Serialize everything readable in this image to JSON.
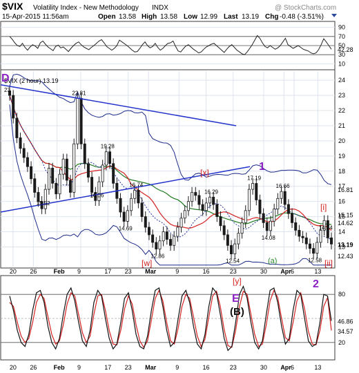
{
  "header": {
    "symbol": "$VIX",
    "name": "Volatility Index - New Methodology",
    "exchange": "INDX",
    "watermark": "@ StockCharts.com",
    "date": "15-Apr-2015 11:56am",
    "open_label": "Open",
    "open": "13.58",
    "high_label": "High",
    "high": "13.58",
    "low_label": "Low",
    "low": "12.99",
    "last_label": "Last",
    "last": "13.19",
    "chg_label": "Chg",
    "chg": "-0.48 (-3.51%)"
  },
  "colors": {
    "price": "#1a1a1a",
    "ma_red": "#d42020",
    "ma_green": "#1f7a1f",
    "ma_blue_dot": "#2030a0",
    "band": "#1c2a8a",
    "annot_purple": "#8a1fc4",
    "annot_red": "#d42020",
    "annot_green": "#2a8a2a",
    "trend": "#2233cc",
    "grid": "#dde4ee",
    "stoch_k": "#111111",
    "stoch_d": "#d42020"
  },
  "chart_data": [
    {
      "type": "line",
      "panel": "RSI",
      "ylim": [
        0,
        100
      ],
      "yticks": [
        "90",
        "70",
        "50",
        "30",
        "10"
      ],
      "ref_lines": [
        70,
        50,
        30
      ],
      "last_value_label": "42.28",
      "last_value": 42.28,
      "values": [
        70,
        64,
        56,
        50,
        48,
        55,
        46,
        40,
        47,
        52,
        49,
        44,
        56,
        60,
        53,
        47,
        43,
        39,
        48,
        51,
        45,
        47,
        42,
        37,
        44,
        50,
        55,
        58,
        52,
        47,
        44,
        41,
        46,
        50,
        55,
        60,
        63,
        56,
        48,
        44,
        40,
        44,
        50,
        62,
        58,
        54,
        50,
        45,
        40,
        36,
        37,
        44,
        52,
        58,
        50,
        45,
        48,
        55,
        46,
        40,
        44,
        50,
        55,
        56,
        60,
        48,
        38,
        36,
        43,
        49,
        52,
        47,
        42,
        38,
        34,
        36,
        42,
        47,
        50,
        53,
        55,
        50,
        45,
        40,
        35,
        42,
        48,
        52,
        46,
        40,
        36,
        32,
        30,
        36,
        44,
        52,
        62,
        72,
        66,
        56,
        48,
        45,
        50,
        46,
        42,
        45,
        50,
        58,
        66,
        52,
        48,
        44,
        47,
        50,
        46,
        42,
        40,
        38,
        34,
        32,
        34,
        41,
        52,
        65,
        58,
        50,
        42
      ]
    },
    {
      "type": "candlestick",
      "panel": "price",
      "title": "$VIX (2 hour) 13.19",
      "ylim": [
        11.7,
        24.6
      ],
      "yticks": [
        24,
        23,
        22,
        21,
        20,
        19,
        18,
        17,
        16,
        15,
        14,
        13
      ],
      "x_labels": [
        "20",
        "26",
        "Feb",
        "9",
        "17",
        "23",
        "Mar",
        "9",
        "16",
        "23",
        "30",
        "Apr",
        "6",
        "13"
      ],
      "x_label_positions": [
        1,
        7,
        14,
        21,
        29,
        35,
        41,
        50,
        58,
        66,
        75,
        81,
        84,
        91
      ],
      "close": [
        23,
        21.5,
        20.2,
        19.5,
        18.9,
        18.3,
        17.5,
        16.6,
        16.0,
        15.52,
        16.8,
        18.2,
        17.2,
        16.5,
        17.8,
        18.8,
        17.4,
        16.6,
        19.8,
        22.81,
        19.8,
        18.5,
        17.6,
        16.6,
        16.06,
        17.3,
        18.4,
        19.28,
        18.5,
        17.2,
        16.2,
        15.3,
        14.69,
        15.4,
        16.2,
        16.74,
        15.9,
        15.0,
        14.3,
        13.8,
        13.3,
        12.86,
        13.4,
        14.0,
        13.5,
        13.1,
        13.7,
        14.3,
        14.9,
        15.4,
        16.0,
        16.6,
        16.4,
        15.8,
        15.4,
        15.9,
        16.29,
        15.8,
        15.0,
        14.4,
        13.8,
        13.1,
        12.54,
        13.2,
        13.9,
        14.6,
        15.4,
        16.8,
        17.19,
        16.1,
        15.2,
        14.6,
        14.08,
        14.7,
        15.5,
        16.2,
        16.66,
        15.8,
        15.2,
        14.6,
        14.1,
        13.7,
        13.6,
        13.2,
        12.9,
        12.58,
        13.3,
        14.1,
        14.74,
        13.6,
        13.19
      ],
      "series": [
        {
          "name": "price",
          "values": "close"
        },
        {
          "name": "ma_red"
        },
        {
          "name": "ma_green"
        },
        {
          "name": "ma_blue_dot"
        }
      ],
      "band_upper_value": "16.81",
      "band_lower_value": "12.43",
      "right_labels": [
        {
          "text": "16.81",
          "value": 16.81
        },
        {
          "text": "15.15",
          "value": 15.15
        },
        {
          "text": "14.62",
          "value": 14.62
        },
        {
          "text": "13.19",
          "value": 13.19
        },
        {
          "text": "12.43",
          "value": 12.43
        }
      ],
      "price_labels": [
        {
          "text": "23",
          "i": 0,
          "value": 23.0
        },
        {
          "text": "22.81",
          "i": 19,
          "value": 22.81
        },
        {
          "text": "19.28",
          "i": 27,
          "value": 19.28
        },
        {
          "text": "15.52",
          "i": 9,
          "value": 15.52
        },
        {
          "text": "16.06",
          "i": 24,
          "value": 16.06
        },
        {
          "text": "16.74",
          "i": 35,
          "value": 16.74
        },
        {
          "text": "14.69",
          "i": 32,
          "value": 14.69
        },
        {
          "text": "12.86",
          "i": 41,
          "value": 12.86
        },
        {
          "text": "16.29",
          "i": 56,
          "value": 16.29
        },
        {
          "text": "17.19",
          "i": 68,
          "value": 17.19
        },
        {
          "text": "16.66",
          "i": 76,
          "value": 16.66
        },
        {
          "text": "14.08",
          "i": 72,
          "value": 14.08
        },
        {
          "text": "12.54",
          "i": 62,
          "value": 12.54
        },
        {
          "text": "14.74",
          "i": 88,
          "value": 14.74
        },
        {
          "text": "12.58",
          "i": 85,
          "value": 12.58
        }
      ],
      "annotations": [
        {
          "text": "D",
          "color": "annot_purple"
        },
        {
          "text": "1",
          "color": "annot_purple"
        },
        {
          "text": "[x]",
          "color": "annot_red"
        },
        {
          "text": "[w]",
          "color": "annot_red"
        },
        {
          "text": "[i]",
          "color": "annot_red"
        },
        {
          "text": "[ii]",
          "color": "annot_red"
        },
        {
          "text": "(a)",
          "color": "annot_green"
        }
      ]
    },
    {
      "type": "line",
      "panel": "stochastic",
      "ylim": [
        0,
        100
      ],
      "yticks": [
        "80",
        "20"
      ],
      "ref_lines": [
        80,
        50,
        20
      ],
      "right_labels": [
        "46.86",
        "34.57"
      ],
      "last_values": [
        46.86,
        34.57
      ],
      "x_labels": [
        "20",
        "26",
        "Feb",
        "9",
        "17",
        "23",
        "Mar",
        "9",
        "16",
        "23",
        "30",
        "Apr",
        "6",
        "13"
      ],
      "k_values": [
        78,
        60,
        35,
        20,
        15,
        30,
        60,
        82,
        85,
        70,
        40,
        20,
        12,
        25,
        55,
        80,
        88,
        72,
        45,
        22,
        15,
        35,
        70,
        85,
        78,
        50,
        25,
        12,
        18,
        45,
        75,
        82,
        60,
        30,
        15,
        12,
        28,
        60,
        85,
        88,
        65,
        35,
        15,
        20,
        50,
        78,
        85,
        70,
        40,
        18,
        12,
        30,
        65,
        88,
        82,
        55,
        25,
        10,
        15,
        45,
        80,
        90,
        75,
        45,
        20,
        12,
        22,
        55,
        85,
        88,
        70,
        40,
        18,
        25,
        60,
        85,
        80,
        50,
        22,
        15,
        18,
        45,
        80,
        78,
        47
      ],
      "d_values": [
        70,
        65,
        45,
        28,
        20,
        25,
        45,
        70,
        80,
        75,
        52,
        30,
        18,
        22,
        42,
        68,
        82,
        78,
        55,
        32,
        20,
        28,
        55,
        78,
        80,
        60,
        35,
        18,
        17,
        35,
        62,
        78,
        68,
        42,
        22,
        14,
        22,
        48,
        75,
        85,
        72,
        45,
        22,
        18,
        38,
        65,
        80,
        75,
        52,
        28,
        15,
        24,
        52,
        78,
        84,
        65,
        36,
        16,
        14,
        35,
        65,
        84,
        80,
        55,
        30,
        15,
        18,
        42,
        72,
        85,
        76,
        50,
        26,
        22,
        45,
        72,
        82,
        62,
        34,
        18,
        17,
        35,
        65,
        76,
        35
      ],
      "annotations": [
        {
          "text": "[y]",
          "color": "annot_red"
        },
        {
          "text": "E",
          "color": "annot_purple"
        },
        {
          "text": "(B)",
          "color": "#111111"
        },
        {
          "text": "2",
          "color": "annot_purple"
        }
      ]
    }
  ]
}
